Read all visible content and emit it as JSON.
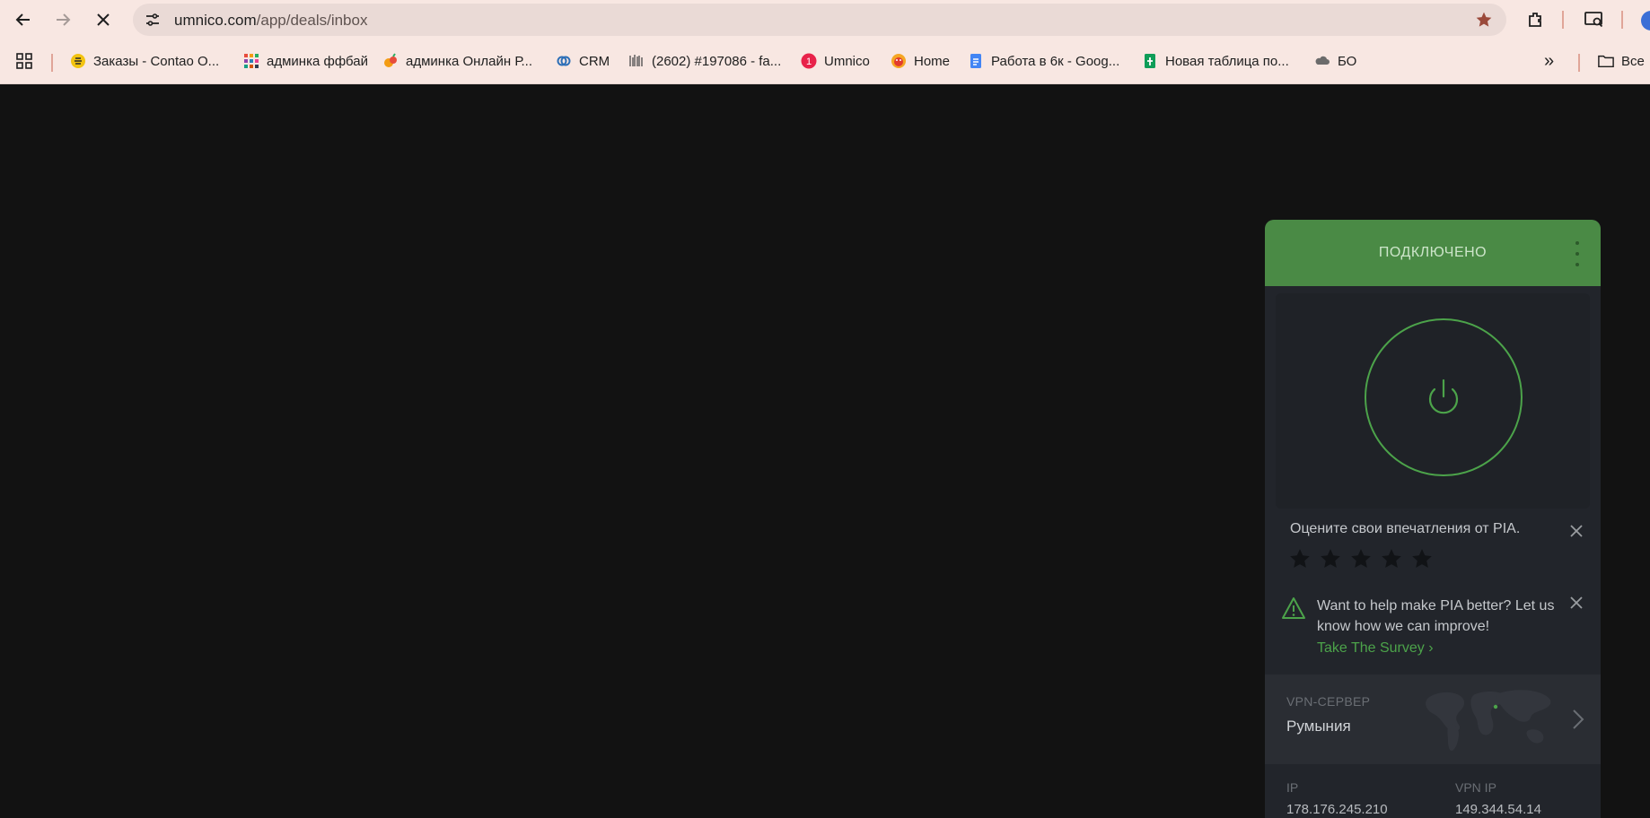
{
  "browser": {
    "url_host": "umnico.com",
    "url_path": "/app/deals/inbox",
    "colors": {
      "chrome_bg": "#f8e7e2",
      "omnibox_bg": "#eadad6",
      "star": "#9b4a3b"
    }
  },
  "bookmarks": [
    {
      "label": "Заказы - Contao O...",
      "icon": "bee-icon"
    },
    {
      "label": "админка ффбай",
      "icon": "grid-colorful-icon"
    },
    {
      "label": "админка Онлайн Р...",
      "icon": "fruit-icon"
    },
    {
      "label": "CRM",
      "icon": "crm-icon"
    },
    {
      "label": "(2602) #197086 - fa...",
      "icon": "barcode-icon"
    },
    {
      "label": "Umnico",
      "icon": "umnico-badge-icon",
      "badge": "1"
    },
    {
      "label": "Home",
      "icon": "home-face-icon"
    },
    {
      "label": "Работа в 6к - Goog...",
      "icon": "google-docs-icon"
    },
    {
      "label": "Новая таблица по...",
      "icon": "google-sheets-icon"
    },
    {
      "label": "БО",
      "icon": "cloud-icon"
    }
  ],
  "bookmarks_overflow": "»",
  "bookmarks_folder": "Все",
  "vpn": {
    "status": "ПОДКЛЮЧЕНО",
    "rate_prompt": "Оцените свои впечатления от PIA.",
    "stars_count": 5,
    "survey_text": "Want to help make PIA better? Let us know how we can improve!",
    "survey_link": "Take The Survey ›",
    "server_label": "VPN-СЕРВЕР",
    "server_name": "Румыния",
    "ip_label": "IP",
    "ip_value": "178.176.245.210",
    "vpn_ip_label": "VPN IP",
    "vpn_ip_value": "149.344.54.14",
    "colors": {
      "header": "#4a8a45",
      "accent": "#4ca34a",
      "panel": "#22252b"
    }
  }
}
